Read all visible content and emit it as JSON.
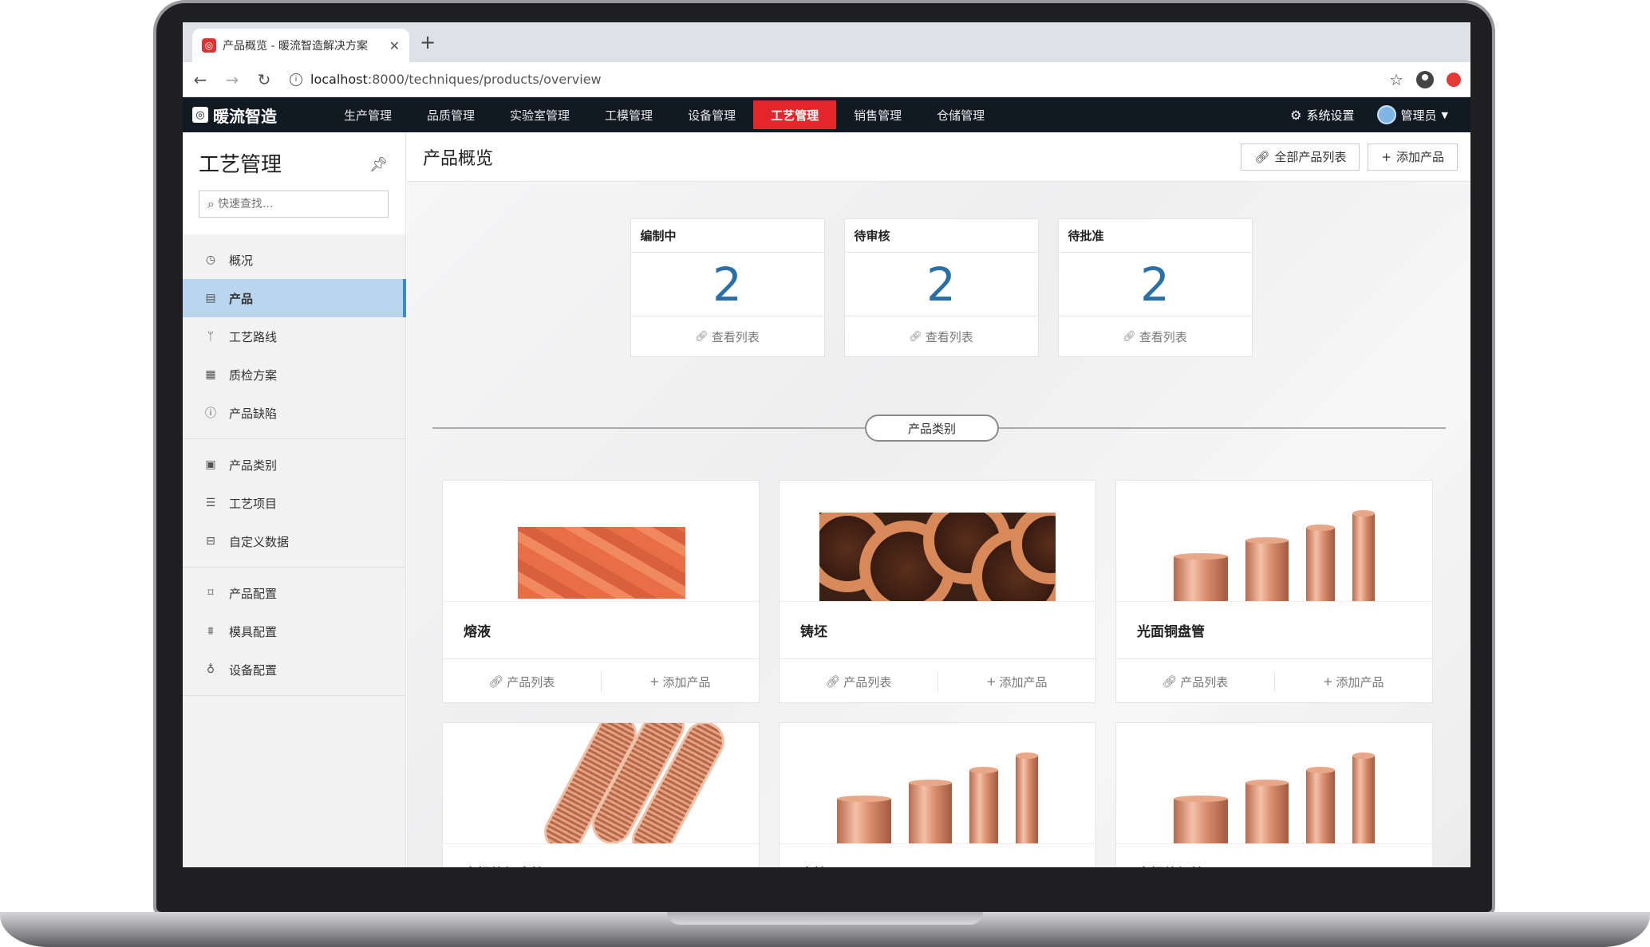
{
  "browser": {
    "tab_title": "产品概览 - 暖流智造解决方案",
    "url_host": "localhost",
    "url_rest": ":8000/techniques/products/overview"
  },
  "app": {
    "brand": "暖流智造",
    "nav": [
      {
        "label": "生产管理",
        "active": false
      },
      {
        "label": "品质管理",
        "active": false
      },
      {
        "label": "实验室管理",
        "active": false
      },
      {
        "label": "工模管理",
        "active": false
      },
      {
        "label": "设备管理",
        "active": false
      },
      {
        "label": "工艺管理",
        "active": true
      },
      {
        "label": "销售管理",
        "active": false
      },
      {
        "label": "仓储管理",
        "active": false
      }
    ],
    "settings_label": "系统设置",
    "user_label": "管理员"
  },
  "sidebar": {
    "title": "工艺管理",
    "search_placeholder": "快速查找...",
    "groups": [
      [
        {
          "label": "概况",
          "icon": "dashboard-icon"
        },
        {
          "label": "产品",
          "icon": "product-icon",
          "active": true
        },
        {
          "label": "工艺路线",
          "icon": "route-icon"
        },
        {
          "label": "质检方案",
          "icon": "inspection-icon"
        },
        {
          "label": "产品缺陷",
          "icon": "defect-icon"
        }
      ],
      [
        {
          "label": "产品类别",
          "icon": "category-icon"
        },
        {
          "label": "工艺项目",
          "icon": "list-icon"
        },
        {
          "label": "自定义数据",
          "icon": "custom-data-icon"
        }
      ],
      [
        {
          "label": "产品配置",
          "icon": "config-icon"
        },
        {
          "label": "模具配置",
          "icon": "mold-icon"
        },
        {
          "label": "设备配置",
          "icon": "bulb-icon"
        }
      ]
    ]
  },
  "main": {
    "title": "产品概览",
    "btn_all_products": "全部产品列表",
    "btn_add_product": "添加产品",
    "stats": [
      {
        "label": "编制中",
        "value": "2",
        "link": "查看列表"
      },
      {
        "label": "待审核",
        "value": "2",
        "link": "查看列表"
      },
      {
        "label": "待批准",
        "value": "2",
        "link": "查看列表"
      }
    ],
    "section_label": "产品类别",
    "categories": [
      {
        "name": "熔液",
        "image": "melt"
      },
      {
        "name": "铸坯",
        "image": "billet"
      },
      {
        "name": "光面铜盘管",
        "image": "tubes"
      },
      {
        "name": "内螺纹铜盘管",
        "image": "spiral"
      },
      {
        "name": "直管",
        "image": "tubes"
      },
      {
        "name": "内螺纹坯管",
        "image": "tubes"
      }
    ],
    "card_list_label": "产品列表",
    "card_add_label": "添加产品"
  }
}
